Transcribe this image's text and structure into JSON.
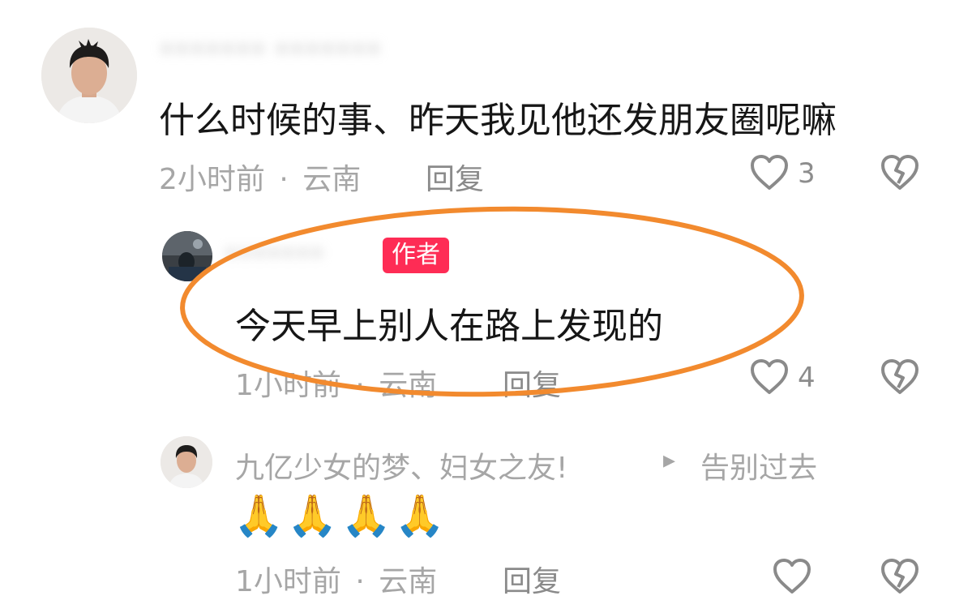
{
  "comment1": {
    "username": "••••••• •••••••",
    "text": "什么时候的事、昨天我见他还发朋友圈呢嘛",
    "time": "2小时前",
    "dot": "·",
    "location": "云南",
    "reply_label": "回复",
    "likes": "3"
  },
  "reply1": {
    "username": "•••••••",
    "badge": "作者",
    "text": "今天早上别人在路上发现的",
    "time": "1小时前",
    "dot": "·",
    "location": "云南",
    "reply_label": "回复",
    "likes": "4"
  },
  "reply2": {
    "username": "九亿少女的梦、妇女之友!",
    "reply_to_arrow": "▸",
    "reply_to": "告别过去",
    "text": "🙏🙏🙏🙏",
    "time": "1小时前",
    "dot": "·",
    "location": "云南",
    "reply_label": "回复"
  },
  "colors": {
    "author_badge": "#fe2c55",
    "highlight_ellipse": "#f28a2e",
    "meta_text": "#a6a6a6"
  },
  "icons": [
    "heart-outline-icon",
    "broken-heart-icon",
    "play-triangle-icon"
  ]
}
